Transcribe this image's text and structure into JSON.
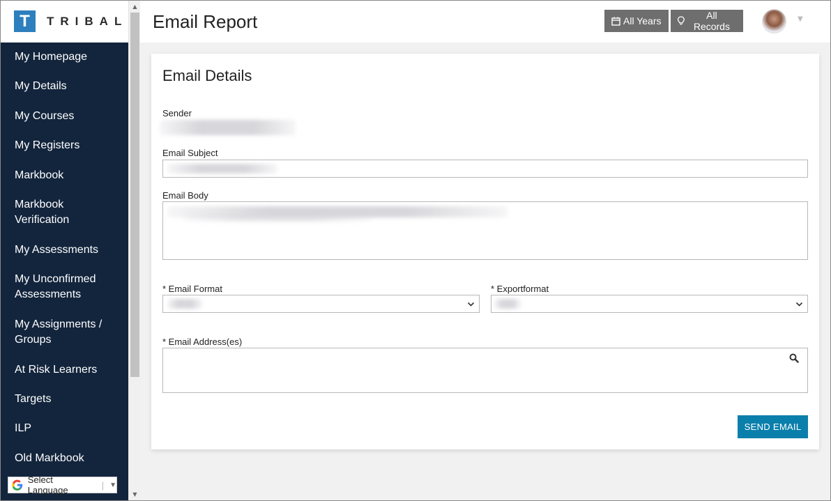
{
  "brand": {
    "logo_letter": "T",
    "logo_text": "TRIBAL"
  },
  "sidebar": {
    "items": [
      {
        "lines": [
          "My Homepage"
        ]
      },
      {
        "lines": [
          "My Details"
        ]
      },
      {
        "lines": [
          "My Courses"
        ]
      },
      {
        "lines": [
          "My Registers"
        ]
      },
      {
        "lines": [
          "Markbook"
        ]
      },
      {
        "lines": [
          "Markbook",
          "Verification"
        ]
      },
      {
        "lines": [
          "My Assessments"
        ]
      },
      {
        "lines": [
          "My Unconfirmed",
          "Assessments"
        ]
      },
      {
        "lines": [
          "My Assignments /",
          "Groups"
        ]
      },
      {
        "lines": [
          "At Risk Learners"
        ]
      },
      {
        "lines": [
          "Targets"
        ]
      },
      {
        "lines": [
          "ILP"
        ]
      },
      {
        "lines": [
          "Old Markbook"
        ]
      }
    ]
  },
  "header": {
    "title": "Email Report",
    "years_label": "All Years",
    "records_label": "All Records"
  },
  "card": {
    "title": "Email Details",
    "sender_label": "Sender",
    "subject_label": "Email Subject",
    "body_label": "Email Body",
    "format_label": "* Email Format",
    "exportformat_label": "* Exportformat",
    "addresses_label": "* Email Address(es)",
    "send_label": "SEND EMAIL"
  },
  "language": {
    "label": "Select Language"
  },
  "colors": {
    "sidebar_bg": "#13253d",
    "accent": "#0b7fab",
    "header_button": "#6e6e6e"
  }
}
